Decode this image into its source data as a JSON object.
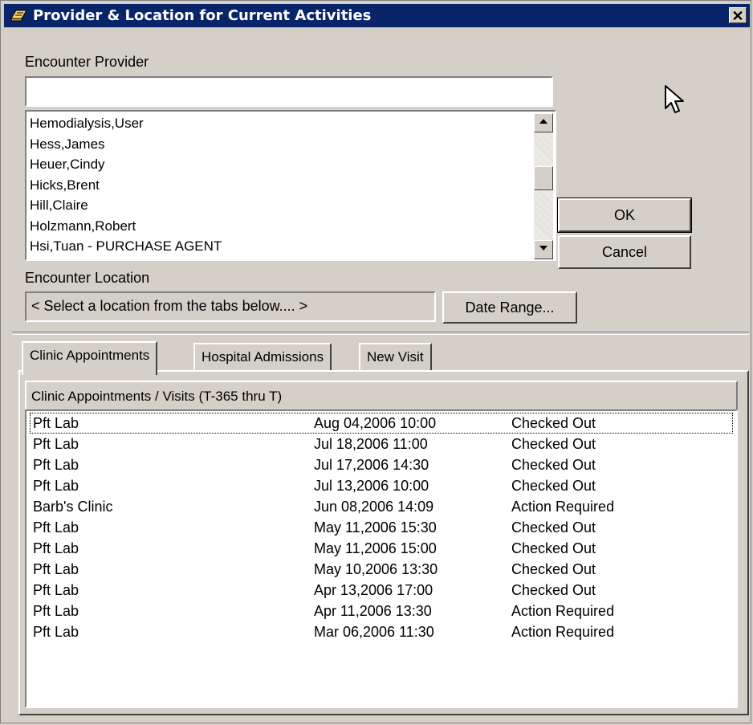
{
  "window": {
    "title": "Provider & Location for Current Activities",
    "close_symbol": "✕",
    "icon": "clipboard-icon"
  },
  "provider": {
    "label": "Encounter Provider",
    "search_value": "",
    "items": [
      "Hemodialysis,User",
      "Hess,James",
      "Heuer,Cindy",
      "Hicks,Brent",
      "Hill,Claire",
      "Holzmann,Robert",
      "Hsi,Tuan - PURCHASE AGENT"
    ]
  },
  "buttons": {
    "ok": "OK",
    "cancel": "Cancel",
    "date_range": "Date Range..."
  },
  "location": {
    "label": "Encounter Location",
    "value": "< Select a location from the tabs below.... >"
  },
  "tabs": [
    {
      "label": "Clinic Appointments",
      "active": true
    },
    {
      "label": "Hospital Admissions",
      "active": false
    },
    {
      "label": "New Visit",
      "active": false
    }
  ],
  "appointments": {
    "header": "Clinic Appointments / Visits  (T-365 thru T)",
    "rows": [
      {
        "location": "Pft Lab",
        "datetime": "Aug 04,2006 10:00",
        "status": "Checked Out",
        "selected": true
      },
      {
        "location": "Pft Lab",
        "datetime": "Jul 18,2006 11:00",
        "status": "Checked Out"
      },
      {
        "location": "Pft Lab",
        "datetime": "Jul 17,2006 14:30",
        "status": "Checked Out"
      },
      {
        "location": "Pft Lab",
        "datetime": "Jul 13,2006 10:00",
        "status": "Checked Out"
      },
      {
        "location": "Barb's Clinic",
        "datetime": "Jun 08,2006 14:09",
        "status": "Action Required"
      },
      {
        "location": "Pft Lab",
        "datetime": "May 11,2006 15:30",
        "status": "Checked Out"
      },
      {
        "location": "Pft Lab",
        "datetime": "May 11,2006 15:00",
        "status": "Checked Out"
      },
      {
        "location": "Pft Lab",
        "datetime": "May 10,2006 13:30",
        "status": "Checked Out"
      },
      {
        "location": "Pft Lab",
        "datetime": "Apr 13,2006 17:00",
        "status": "Checked Out"
      },
      {
        "location": "Pft Lab",
        "datetime": "Apr 11,2006 13:30",
        "status": "Action Required"
      },
      {
        "location": "Pft Lab",
        "datetime": "Mar 06,2006 11:30",
        "status": "Action Required"
      }
    ]
  },
  "colors": {
    "titlebar": "#0a246a",
    "face": "#d4d0c8"
  }
}
